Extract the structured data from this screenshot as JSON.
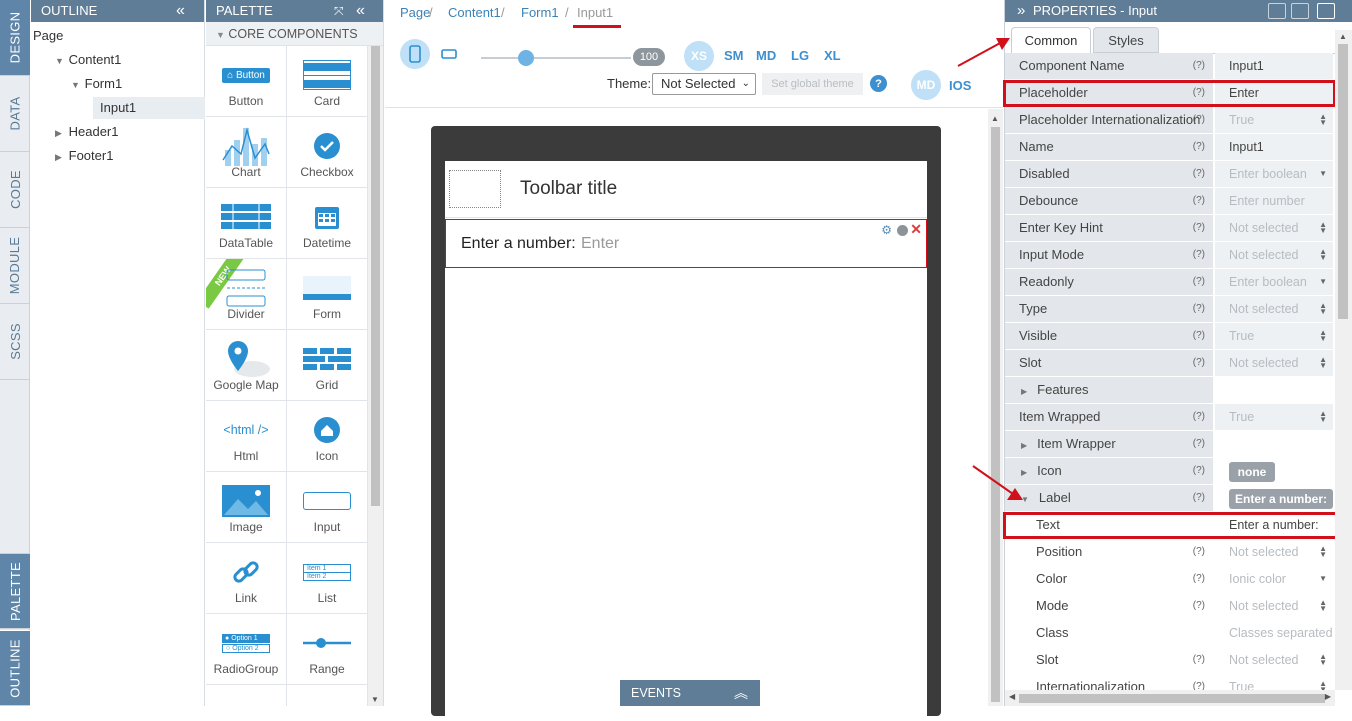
{
  "vertical_tabs": {
    "design": "DESIGN",
    "data": "DATA",
    "code": "CODE",
    "module": "MODULE",
    "scss": "SCSS",
    "palette": "PALETTE",
    "outline": "OUTLINE"
  },
  "outline": {
    "title": "OUTLINE",
    "tree": [
      {
        "label": "Page"
      },
      {
        "label": "Content1"
      },
      {
        "label": "Form1"
      },
      {
        "label": "Input1"
      },
      {
        "label": "Header1"
      },
      {
        "label": "Footer1"
      }
    ]
  },
  "palette": {
    "title": "PALETTE",
    "section": "CORE COMPONENTS",
    "items": [
      {
        "label": "Button",
        "icon": "button-icon",
        "icon_text": "Button"
      },
      {
        "label": "Card",
        "icon": "card-icon"
      },
      {
        "label": "Chart",
        "icon": "chart-icon"
      },
      {
        "label": "Checkbox",
        "icon": "checkbox-icon"
      },
      {
        "label": "DataTable",
        "icon": "datatable-icon"
      },
      {
        "label": "Datetime",
        "icon": "datetime-icon"
      },
      {
        "label": "Divider",
        "icon": "divider-icon",
        "badge": "NEW"
      },
      {
        "label": "Form",
        "icon": "form-icon"
      },
      {
        "label": "Google Map",
        "icon": "map-pin-icon"
      },
      {
        "label": "Grid",
        "icon": "grid-icon"
      },
      {
        "label": "Html",
        "icon": "html-icon",
        "icon_text": "<html />"
      },
      {
        "label": "Icon",
        "icon": "home-icon"
      },
      {
        "label": "Image",
        "icon": "image-icon"
      },
      {
        "label": "Input",
        "icon": "input-icon"
      },
      {
        "label": "Link",
        "icon": "link-icon"
      },
      {
        "label": "List",
        "icon": "list-icon",
        "icon_lines": [
          "Item 1",
          "Item 2"
        ]
      },
      {
        "label": "RadioGroup",
        "icon": "radiogroup-icon",
        "icon_lines": [
          "Option 1",
          "Option 2"
        ]
      },
      {
        "label": "Range",
        "icon": "range-icon"
      }
    ]
  },
  "breadcrumb": [
    "Page",
    "Content1",
    "Form1",
    "Input1"
  ],
  "toolbar": {
    "zoom_value": "100",
    "zoom_fraction": 0.3,
    "sizes": [
      "XS",
      "SM",
      "MD",
      "LG",
      "XL"
    ],
    "active_size": "XS",
    "theme_label": "Theme:",
    "theme_value": "Not Selected",
    "global_theme_button": "Set global theme",
    "help": "?",
    "platforms": [
      "MD",
      "IOS"
    ]
  },
  "canvas": {
    "toolbar_title": "Toolbar title",
    "input_label": "Enter a number:",
    "input_placeholder": "Enter",
    "events_label": "EVENTS"
  },
  "properties": {
    "title": "PROPERTIES - Input",
    "tabs": [
      "Common",
      "Styles"
    ],
    "active_tab": "Common",
    "rows": [
      {
        "name": "Component Name",
        "help": "(?)",
        "value": "Input1",
        "value_style": "dark"
      },
      {
        "name": "Placeholder",
        "help": "(?)",
        "value": "Enter",
        "value_style": "dark",
        "highlight": true
      },
      {
        "name": "Placeholder Internationalization",
        "help": "(?)",
        "value": "True",
        "control": "spin"
      },
      {
        "name": "Name",
        "help": "(?)",
        "value": "Input1",
        "value_style": "dark"
      },
      {
        "name": "Disabled",
        "help": "(?)",
        "value": "Enter boolean",
        "control": "drop"
      },
      {
        "name": "Debounce",
        "help": "(?)",
        "value": "Enter number"
      },
      {
        "name": "Enter Key Hint",
        "help": "(?)",
        "value": "Not selected",
        "control": "spin"
      },
      {
        "name": "Input Mode",
        "help": "(?)",
        "value": "Not selected",
        "control": "spin"
      },
      {
        "name": "Readonly",
        "help": "(?)",
        "value": "Enter boolean",
        "control": "drop"
      },
      {
        "name": "Type",
        "help": "(?)",
        "value": "Not selected",
        "control": "spin"
      },
      {
        "name": "Visible",
        "help": "(?)",
        "value": "True",
        "control": "spin"
      },
      {
        "name": "Slot",
        "help": "(?)",
        "value": "Not selected",
        "control": "spin"
      },
      {
        "name": "Features",
        "help": "",
        "value": "",
        "group": true,
        "indent": 1
      },
      {
        "name": "Item Wrapped",
        "help": "(?)",
        "value": "True",
        "control": "spin"
      },
      {
        "name": "Item Wrapper",
        "help": "(?)",
        "value": "",
        "group": true,
        "indent": 1
      },
      {
        "name": "Icon",
        "help": "(?)",
        "value": "none",
        "group": true,
        "indent": 1,
        "chip": true
      },
      {
        "name": "Label",
        "help": "(?)",
        "value": "Enter a number:",
        "group": true,
        "indent": 1,
        "chip": true,
        "expanded": true
      },
      {
        "name": "Text",
        "help": "",
        "value": "Enter a number:",
        "value_style": "dark",
        "indent": 2,
        "highlight": true
      },
      {
        "name": "Position",
        "help": "(?)",
        "value": "Not selected",
        "indent": 2,
        "control": "spin"
      },
      {
        "name": "Color",
        "help": "(?)",
        "value": "Ionic color",
        "indent": 2,
        "control": "drop"
      },
      {
        "name": "Mode",
        "help": "(?)",
        "value": "Not selected",
        "indent": 2,
        "control": "spin"
      },
      {
        "name": "Class",
        "help": "",
        "value": "Classes separated",
        "indent": 2
      },
      {
        "name": "Slot",
        "help": "(?)",
        "value": "Not selected",
        "indent": 2,
        "control": "spin"
      },
      {
        "name": "Internationalization",
        "help": "(?)",
        "value": "True",
        "indent": 2,
        "control": "spin"
      }
    ]
  },
  "colors": {
    "accent": "#3d8fd0",
    "header": "#5f7d96",
    "highlight": "#d0111b"
  }
}
